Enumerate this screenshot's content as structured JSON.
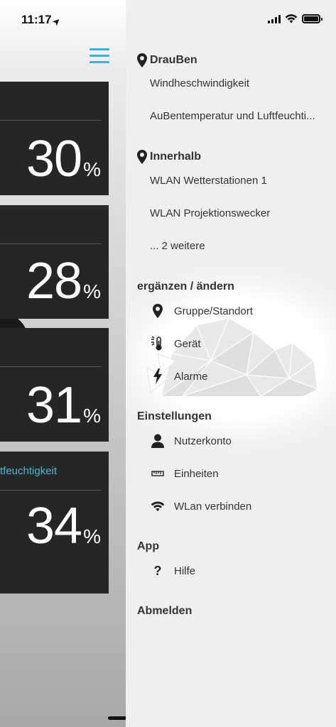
{
  "status_bar": {
    "time": "11:17"
  },
  "main": {
    "cards": [
      {
        "value": "30",
        "unit": "%",
        "label": ""
      },
      {
        "value": "28",
        "unit": "%",
        "label": ""
      },
      {
        "value": "31",
        "unit": "%",
        "label": ""
      },
      {
        "value": "34",
        "unit": "%",
        "label": "tfeuchtigkeit"
      }
    ]
  },
  "drawer": {
    "outside": {
      "title": "DrauBen",
      "items": [
        "Windheschwindigkeit",
        "AuBentemperatur und Luftfeuchti..."
      ]
    },
    "inside": {
      "title": "Innerhalb",
      "items": [
        "WLAN Wetterstationen 1",
        "WLAN Projektionswecker",
        "... 2 weitere"
      ]
    },
    "edit": {
      "title": "ergänzen / ändern",
      "items": [
        {
          "label": "Gruppe/Standort",
          "icon": "location-pin-icon"
        },
        {
          "label": "Gerät",
          "icon": "thermometer-icon"
        },
        {
          "label": "Alarme",
          "icon": "lightning-icon"
        }
      ]
    },
    "settings": {
      "title": "Einstellungen",
      "items": [
        {
          "label": "Nutzerkonto",
          "icon": "user-icon"
        },
        {
          "label": "Einheiten",
          "icon": "ruler-icon"
        },
        {
          "label": "WLan verbinden",
          "icon": "wifi-icon"
        }
      ]
    },
    "app": {
      "title": "App",
      "items": [
        {
          "label": "Hilfe",
          "icon": "question-icon"
        }
      ]
    },
    "logout": "Abmelden"
  },
  "colors": {
    "accent": "#3bb0d6",
    "card_bg": "#262626",
    "drawer_bg": "#efefef"
  }
}
